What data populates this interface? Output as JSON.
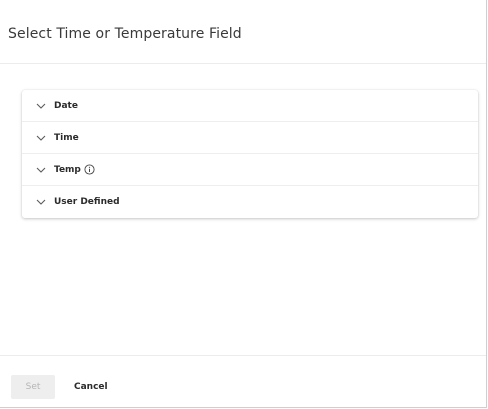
{
  "dialog": {
    "title": "Select Time or Temperature Field"
  },
  "fields": [
    {
      "label": "Date",
      "icon": "chevron-down-icon",
      "has_info": false
    },
    {
      "label": "Time",
      "icon": "chevron-down-icon",
      "has_info": false
    },
    {
      "label": "Temp",
      "icon": "chevron-down-icon",
      "has_info": true
    },
    {
      "label": "User Defined",
      "icon": "chevron-down-icon",
      "has_info": false
    }
  ],
  "footer": {
    "set_label": "Set",
    "cancel_label": "Cancel",
    "set_disabled": true
  },
  "colors": {
    "title_text": "#3a3a3a",
    "label_text": "#2b2b2b",
    "disabled_button_bg": "#eeeeee",
    "disabled_button_text": "#b5b5b5",
    "divider": "#ececec"
  }
}
